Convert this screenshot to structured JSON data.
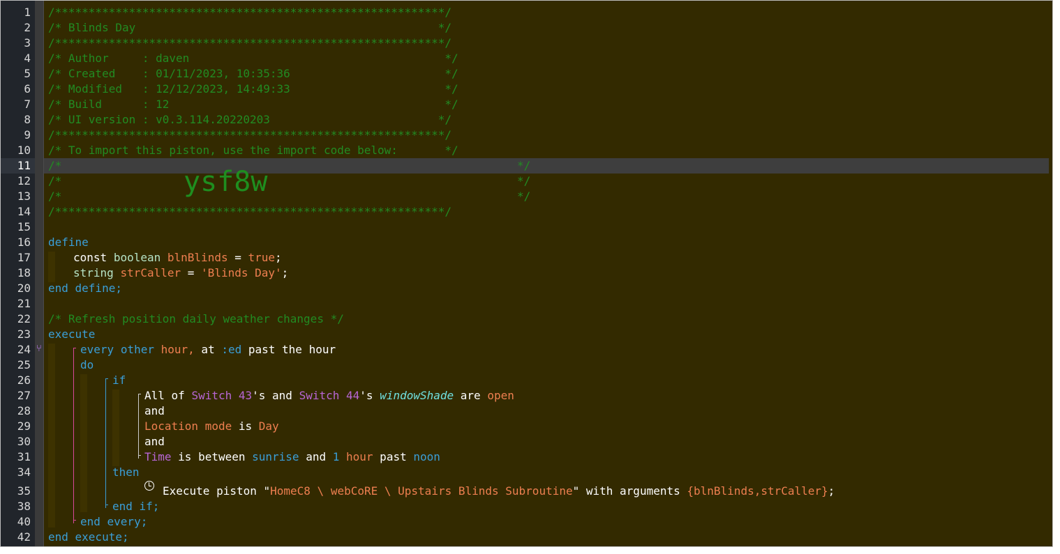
{
  "editor": {
    "current_line": "11",
    "line_numbers": [
      "1",
      "2",
      "3",
      "4",
      "5",
      "6",
      "7",
      "8",
      "9",
      "10",
      "11",
      "12",
      "13",
      "14",
      "15",
      "16",
      "17",
      "18",
      "20",
      "21",
      "22",
      "23",
      "24",
      "25",
      "26",
      "27",
      "28",
      "29",
      "30",
      "31",
      "34",
      "35",
      "38",
      "40",
      "42"
    ],
    "header": {
      "border": "/**********************************************************/",
      "title": "/* Blinds Day                                             */",
      "author": "/* Author     : daven                                      */",
      "created": "/* Created    : 01/11/2023, 10:35:36                       */",
      "modified": "/* Modified   : 12/12/2023, 14:49:33                       */",
      "build": "/* Build      : 12                                         */",
      "ui_version": "/* UI version : v0.3.114.20220203                         */",
      "import_note": "/* To import this piston, use the import code below:       */",
      "blank_open": "/*",
      "blank_close": "*/",
      "import_code": "ysf8w"
    },
    "define": {
      "kw_define": "define",
      "const": "const",
      "boolean": "boolean",
      "var1": "blnBlinds",
      "eq": " = ",
      "true": "true",
      "semi": ";",
      "string": "string",
      "var2": "strCaller",
      "val2": "'Blinds Day'",
      "end": "end define;"
    },
    "comment": "/* Refresh position daily weather changes */",
    "execute": {
      "kw_execute": "execute",
      "every": "every",
      "other": "other",
      "hour": "hour,",
      "at": " at ",
      "ed": ":ed",
      "past_hour": " past the hour",
      "do": "do",
      "if": "if",
      "all_of": "All of ",
      "sw43": "Switch 43",
      "s_and": "'s and ",
      "sw44": "Switch 44",
      "s_": "'s ",
      "attr": "windowShade",
      "are": " are ",
      "open": "open",
      "and": "and",
      "location_mode": "Location mode",
      "is": " is ",
      "day": "Day",
      "time": "Time",
      "is_between": " is between ",
      "sunrise": "sunrise",
      "and_w": " and ",
      "one": "1",
      "hour_w": "hour",
      "past": " past ",
      "noon": "noon",
      "then": "then",
      "exec_piston": "Execute piston \"",
      "piston_name": "HomeC8 \\ webCoRE \\ Upstairs Blinds Subroutine",
      "with_args": "\" with arguments ",
      "args": "{blnBlinds,strCaller}",
      "end_if": "end if;",
      "end_every": "end every;",
      "end_execute": "end execute;"
    },
    "colors": {
      "background": "#332a00",
      "comment": "#228b22",
      "keyword": "#3a9fd8",
      "literal": "#ee7f50",
      "device": "#b866d6"
    }
  }
}
